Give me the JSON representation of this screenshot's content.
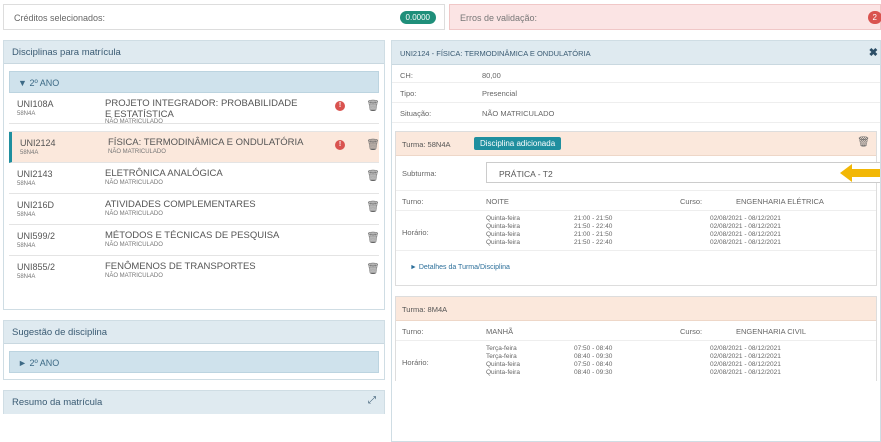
{
  "top": {
    "credits_label": "Créditos selecionados:",
    "credits_value": "0.0000",
    "errors_label": "Erros de validação:",
    "errors_count": "2"
  },
  "left": {
    "enroll_title": "Disciplinas para matrícula",
    "year_label": "2º ANO",
    "courses": [
      {
        "code": "UNI108A",
        "class": "58N4A",
        "name": "PROJETO INTEGRADOR: PROBABILIDADE E ESTATÍSTICA",
        "status": "NÃO MATRICULADO",
        "warn": true
      },
      {
        "code": "UNI2124",
        "class": "58N4A",
        "name": "FÍSICA: TERMODINÂMICA E ONDULATÓRIA",
        "status": "NÃO MATRICULADO",
        "warn": true
      },
      {
        "code": "UNI2143",
        "class": "58N4A",
        "name": "ELETRÔNICA ANALÓGICA",
        "status": "NÃO MATRICULADO",
        "warn": false
      },
      {
        "code": "UNI216D",
        "class": "58N4A",
        "name": "ATIVIDADES COMPLEMENTARES",
        "status": "NÃO MATRICULADO",
        "warn": false
      },
      {
        "code": "UNI599/2",
        "class": "58N4A",
        "name": "MÉTODOS E TÉCNICAS DE PESQUISA",
        "status": "NÃO MATRICULADO",
        "warn": false
      },
      {
        "code": "UNI855/2",
        "class": "58N4A",
        "name": "FENÔMENOS DE TRANSPORTES",
        "status": "NÃO MATRICULADO",
        "warn": false
      }
    ],
    "suggestion_title": "Sugestão de disciplina",
    "suggestion_year": "2º ANO",
    "summary_title": "Resumo da matrícula"
  },
  "right": {
    "title": "UNI2124 - FÍSICA: TERMODINÂMICA E ONDULATÓRIA",
    "ch_label": "CH:",
    "ch_value": "80,00",
    "tipo_label": "Tipo:",
    "tipo_value": "Presencial",
    "situacao_label": "Situação:",
    "situacao_value": "NÃO MATRICULADO",
    "turma1": {
      "label": "Turma: 58N4A",
      "tag": "Disciplina adicionada",
      "subturma_label": "Subturma:",
      "subturma_value": "PRÁTICA - T2",
      "turno_label": "Turno:",
      "turno_value": "NOITE",
      "curso_label": "Curso:",
      "curso_value": "ENGENHARIA ELÉTRICA",
      "horario_label": "Horário:",
      "schedule": [
        {
          "day": "Quinta-feira",
          "time": "21:00 - 21:50",
          "dates": "02/08/2021 - 08/12/2021"
        },
        {
          "day": "Quinta-feira",
          "time": "21:50 - 22:40",
          "dates": "02/08/2021 - 08/12/2021"
        },
        {
          "day": "Quinta-feira",
          "time": "21:00 - 21:50",
          "dates": "02/08/2021 - 08/12/2021"
        },
        {
          "day": "Quinta-feira",
          "time": "21:50 - 22:40",
          "dates": "02/08/2021 - 08/12/2021"
        }
      ],
      "details_link": "Detalhes da Turma/Disciplina"
    },
    "turma2": {
      "label": "Turma: 8M4A",
      "turno_label": "Turno:",
      "turno_value": "MANHÃ",
      "curso_label": "Curso:",
      "curso_value": "ENGENHARIA CIVIL",
      "horario_label": "Horário:",
      "schedule": [
        {
          "day": "Terça-feira",
          "time": "07:50 - 08:40",
          "dates": "02/08/2021 - 08/12/2021"
        },
        {
          "day": "Terça-feira",
          "time": "08:40 - 09:30",
          "dates": "02/08/2021 - 08/12/2021"
        },
        {
          "day": "Quinta-feira",
          "time": "07:50 - 08:40",
          "dates": "02/08/2021 - 08/12/2021"
        },
        {
          "day": "Quinta-feira",
          "time": "08:40 - 09:30",
          "dates": "02/08/2021 - 08/12/2021"
        }
      ]
    },
    "accent_color": "#1f8f9f",
    "arrow_color": "#f2b705"
  }
}
